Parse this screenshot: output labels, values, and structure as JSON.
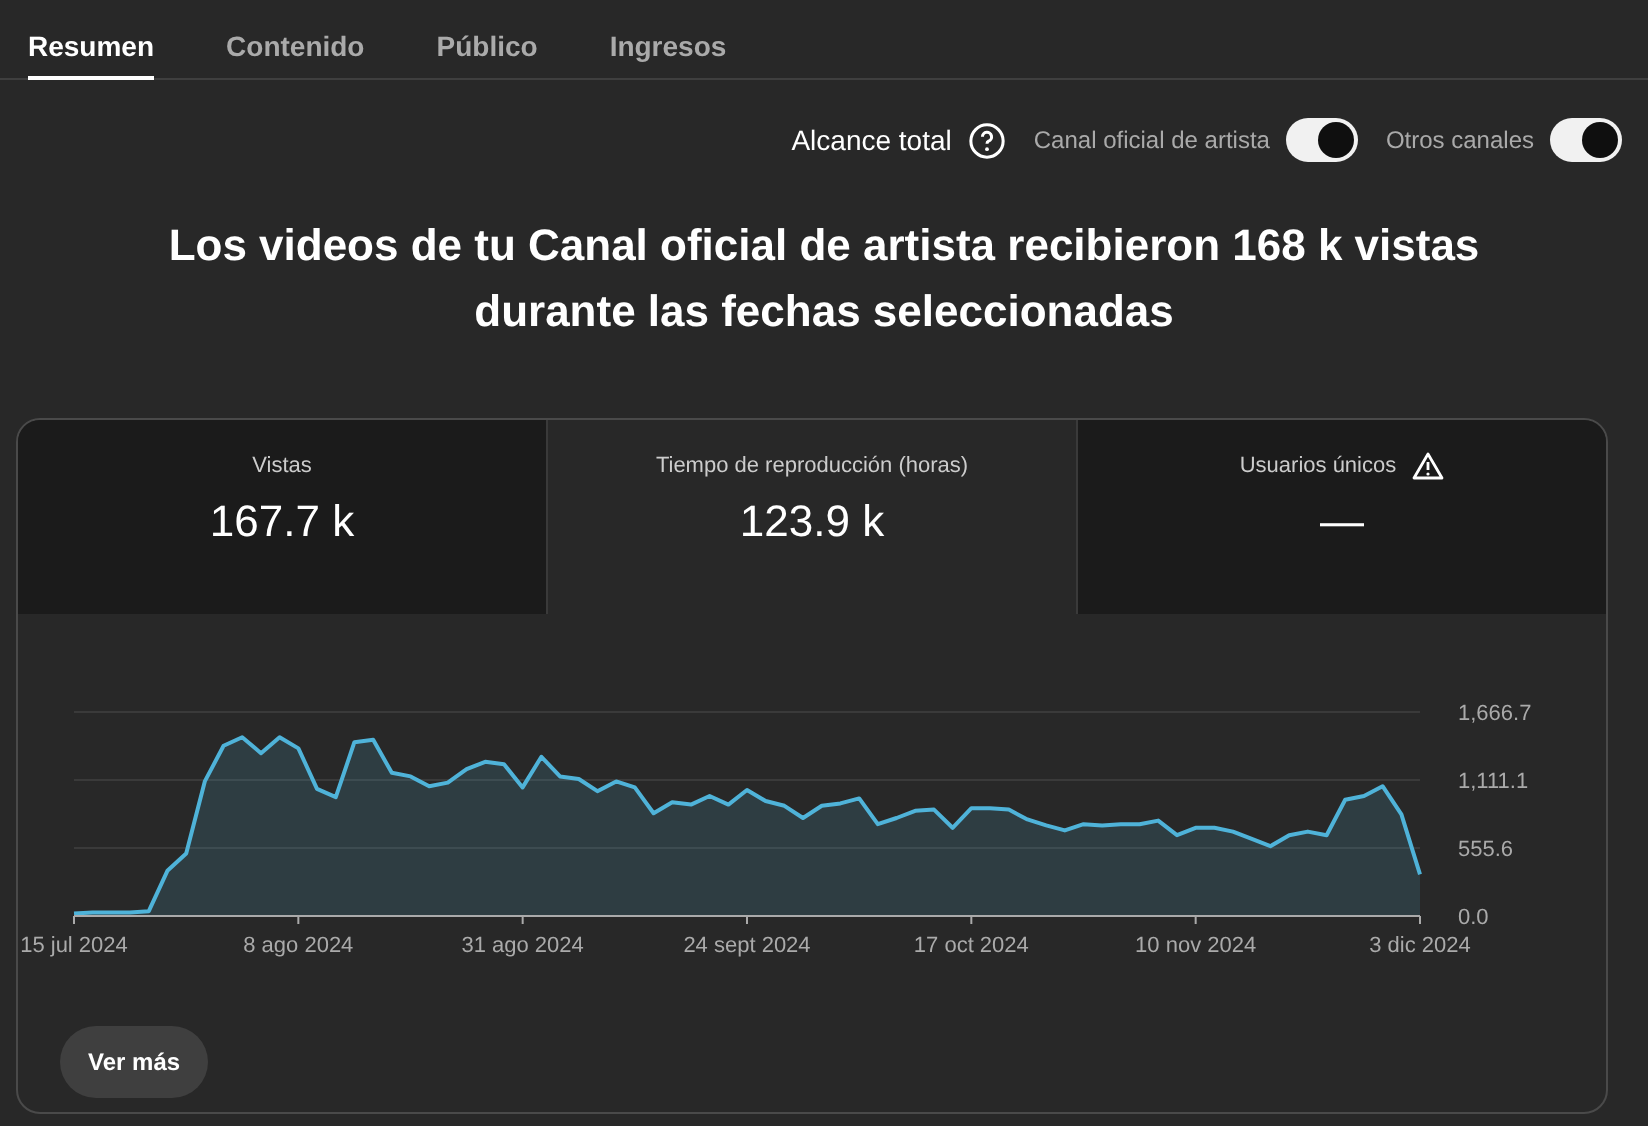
{
  "tabs": [
    {
      "label": "Resumen",
      "selected": true
    },
    {
      "label": "Contenido",
      "selected": false
    },
    {
      "label": "Público",
      "selected": false
    },
    {
      "label": "Ingresos",
      "selected": false
    }
  ],
  "filters": {
    "reach_label": "Alcance total",
    "toggles": [
      {
        "label": "Canal oficial de artista",
        "on": true
      },
      {
        "label": "Otros canales",
        "on": true
      }
    ]
  },
  "headline": "Los videos de tu Canal oficial de artista recibieron 168 k vistas durante las fechas seleccionadas",
  "metrics": [
    {
      "label": "Vistas",
      "value": "167.7 k",
      "selected": false,
      "warning": false
    },
    {
      "label": "Tiempo de reproducción (horas)",
      "value": "123.9 k",
      "selected": true,
      "warning": false
    },
    {
      "label": "Usuarios únicos",
      "value": "—",
      "selected": false,
      "warning": true
    }
  ],
  "chart_data": {
    "type": "area",
    "categories": [
      "15 jul 2024",
      null,
      null,
      null,
      null,
      null,
      null,
      null,
      null,
      null,
      null,
      null,
      "8 ago 2024",
      null,
      null,
      null,
      null,
      null,
      null,
      null,
      null,
      null,
      null,
      null,
      "31 ago 2024",
      null,
      null,
      null,
      null,
      null,
      null,
      null,
      null,
      null,
      null,
      null,
      "24 sept 2024",
      null,
      null,
      null,
      null,
      null,
      null,
      null,
      null,
      null,
      null,
      null,
      "17 oct 2024",
      null,
      null,
      null,
      null,
      null,
      null,
      null,
      null,
      null,
      null,
      null,
      "10 nov 2024",
      null,
      null,
      null,
      null,
      null,
      null,
      null,
      null,
      null,
      null,
      null,
      "3 dic 2024"
    ],
    "series": [
      {
        "color": "#4fb3d9",
        "values": [
          20,
          30,
          30,
          30,
          40,
          370,
          510,
          1100,
          1390,
          1460,
          1330,
          1460,
          1370,
          1040,
          970,
          1420,
          1440,
          1170,
          1140,
          1060,
          1090,
          1200,
          1260,
          1240,
          1050,
          1300,
          1140,
          1120,
          1020,
          1100,
          1050,
          840,
          930,
          910,
          980,
          910,
          1030,
          940,
          900,
          800,
          900,
          920,
          960,
          750,
          800,
          860,
          870,
          720,
          880,
          880,
          870,
          790,
          740,
          700,
          750,
          740,
          750,
          750,
          780,
          660,
          720,
          720,
          690,
          630,
          570,
          660,
          690,
          660,
          950,
          980,
          1060,
          830,
          340
        ]
      }
    ],
    "ylim": [
      0,
      1666.7
    ],
    "yticks": [
      {
        "value": 0,
        "label": "0.0"
      },
      {
        "value": 555.6,
        "label": "555.6"
      },
      {
        "value": 1111.1,
        "label": "1,111.1"
      },
      {
        "value": 1666.7,
        "label": "1,666.7"
      }
    ]
  },
  "more_button": "Ver más"
}
